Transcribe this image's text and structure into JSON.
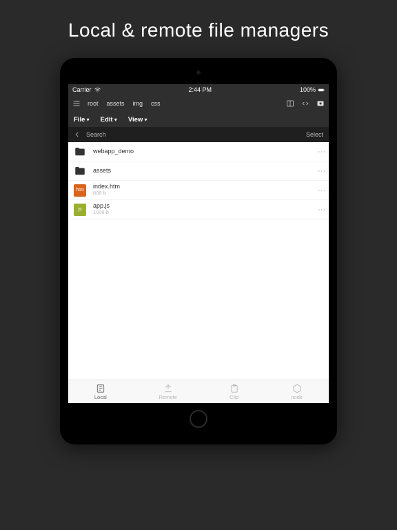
{
  "headline": "Local & remote file managers",
  "status": {
    "carrier": "Carrier",
    "time": "2:44 PM",
    "battery": "100%"
  },
  "breadcrumbs": [
    "root",
    "assets",
    "img",
    "css"
  ],
  "menus": {
    "file": "File",
    "edit": "Edit",
    "view": "View"
  },
  "search": {
    "placeholder": "Search",
    "select": "Select"
  },
  "files": [
    {
      "name": "webapp_demo",
      "type": "folder",
      "sub": ""
    },
    {
      "name": "assets",
      "type": "folder",
      "sub": ""
    },
    {
      "name": "index.htm",
      "type": "htm",
      "sub": "808 b",
      "badge": "htm"
    },
    {
      "name": "app.js",
      "type": "js",
      "sub": "1008 b",
      "badge": "js"
    }
  ],
  "tabs": [
    {
      "label": "Local",
      "active": true
    },
    {
      "label": "Remote",
      "active": false
    },
    {
      "label": "Clip",
      "active": false
    },
    {
      "label": "node",
      "active": false
    }
  ]
}
